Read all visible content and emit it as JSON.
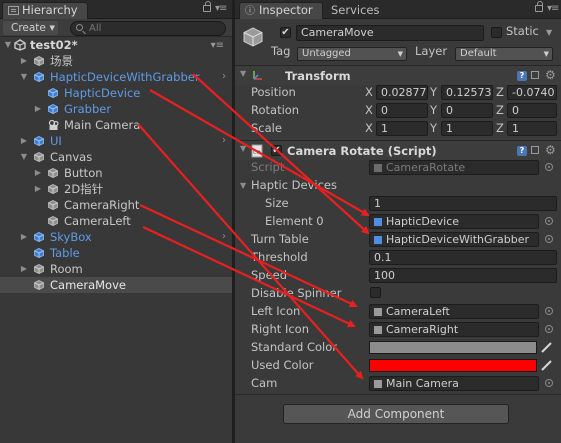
{
  "hierarchy": {
    "tab_label": "Hierarchy",
    "create_label": "Create",
    "search_placeholder": "All",
    "scene_name": "test02*",
    "items": [
      {
        "label": "场景"
      },
      {
        "label": "HapticDeviceWithGrabber"
      },
      {
        "label": "HapticDevice"
      },
      {
        "label": "Grabber"
      },
      {
        "label": "Main Camera"
      },
      {
        "label": "UI"
      },
      {
        "label": "Canvas"
      },
      {
        "label": "Button"
      },
      {
        "label": "2D指针"
      },
      {
        "label": "CameraRight"
      },
      {
        "label": "CameraLeft"
      },
      {
        "label": "SkyBox"
      },
      {
        "label": "Table"
      },
      {
        "label": "Room"
      },
      {
        "label": "CameraMove"
      }
    ]
  },
  "inspector": {
    "tab_label": "Inspector",
    "services_label": "Services",
    "object_name": "CameraMove",
    "static_label": "Static",
    "tag_label": "Tag",
    "tag_value": "Untagged",
    "layer_label": "Layer",
    "layer_value": "Default",
    "transform": {
      "title": "Transform",
      "position_label": "Position",
      "rotation_label": "Rotation",
      "scale_label": "Scale",
      "position": {
        "x": "0.02877",
        "y": "0.12573",
        "z": "-0.0740"
      },
      "rotation": {
        "x": "0",
        "y": "0",
        "z": "0"
      },
      "scale": {
        "x": "1",
        "y": "1",
        "z": "1"
      }
    },
    "script_component": {
      "title": "Camera Rotate (Script)",
      "script_label": "Script",
      "script_value": "CameraRotate",
      "haptic_devices_label": "Haptic Devices",
      "size_label": "Size",
      "size_value": "1",
      "element0_label": "Element 0",
      "element0_value": "HapticDevice",
      "turn_table_label": "Turn Table",
      "turn_table_value": "HapticDeviceWithGrabber",
      "threshold_label": "Threshold",
      "threshold_value": "0.1",
      "speed_label": "Speed",
      "speed_value": "100",
      "disable_spinner_label": "Disable Spinner",
      "left_icon_label": "Left Icon",
      "left_icon_value": "CameraLeft",
      "right_icon_label": "Right Icon",
      "right_icon_value": "CameraRight",
      "standard_color_label": "Standard Color",
      "standard_color": "#8c8c8c",
      "used_color_label": "Used Color",
      "used_color": "#ff0000",
      "cam_label": "Cam",
      "cam_value": "Main Camera"
    },
    "add_component_label": "Add Component"
  },
  "colors": {
    "selection_blue": "#5e9ce8",
    "arrow_red": "#e82020",
    "cube_blue": "#4f8fe0"
  }
}
